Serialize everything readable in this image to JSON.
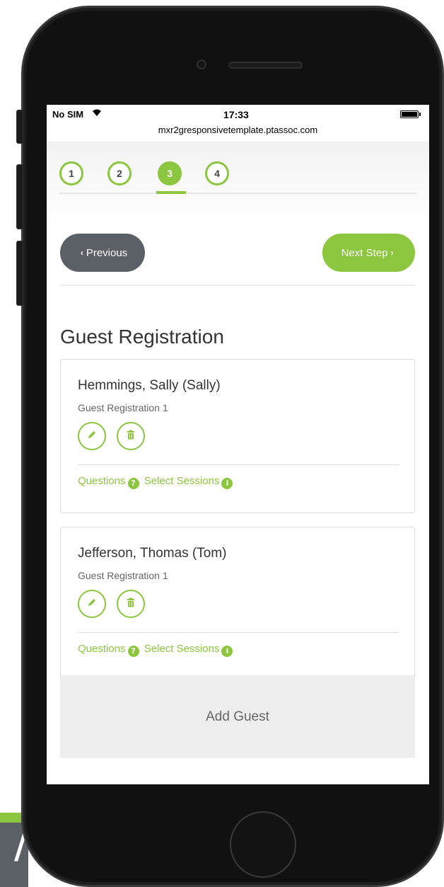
{
  "status_bar": {
    "carrier": "No SIM",
    "time": "17:33",
    "url": "mxr2gresponsivetemplate.ptassoc.com"
  },
  "steps": [
    {
      "label": "1",
      "active": false
    },
    {
      "label": "2",
      "active": false
    },
    {
      "label": "3",
      "active": true
    },
    {
      "label": "4",
      "active": false
    }
  ],
  "nav": {
    "previous_label": "Previous",
    "next_label": "Next Step"
  },
  "section": {
    "title": "Guest Registration"
  },
  "guests": [
    {
      "name": "Hemmings, Sally (Sally)",
      "registration": "Guest Registration 1",
      "questions_label": "Questions",
      "sessions_label": "Select Sessions"
    },
    {
      "name": "Jefferson, Thomas (Tom)",
      "registration": "Guest Registration 1",
      "questions_label": "Questions",
      "sessions_label": "Select Sessions"
    }
  ],
  "add_guest_label": "Add Guest",
  "colors": {
    "accent": "#8cc63f",
    "secondary": "#5b6066"
  },
  "icons": {
    "edit": "pencil-icon",
    "delete": "trash-icon",
    "questions": "question-circle-icon",
    "sessions": "info-circle-icon"
  }
}
